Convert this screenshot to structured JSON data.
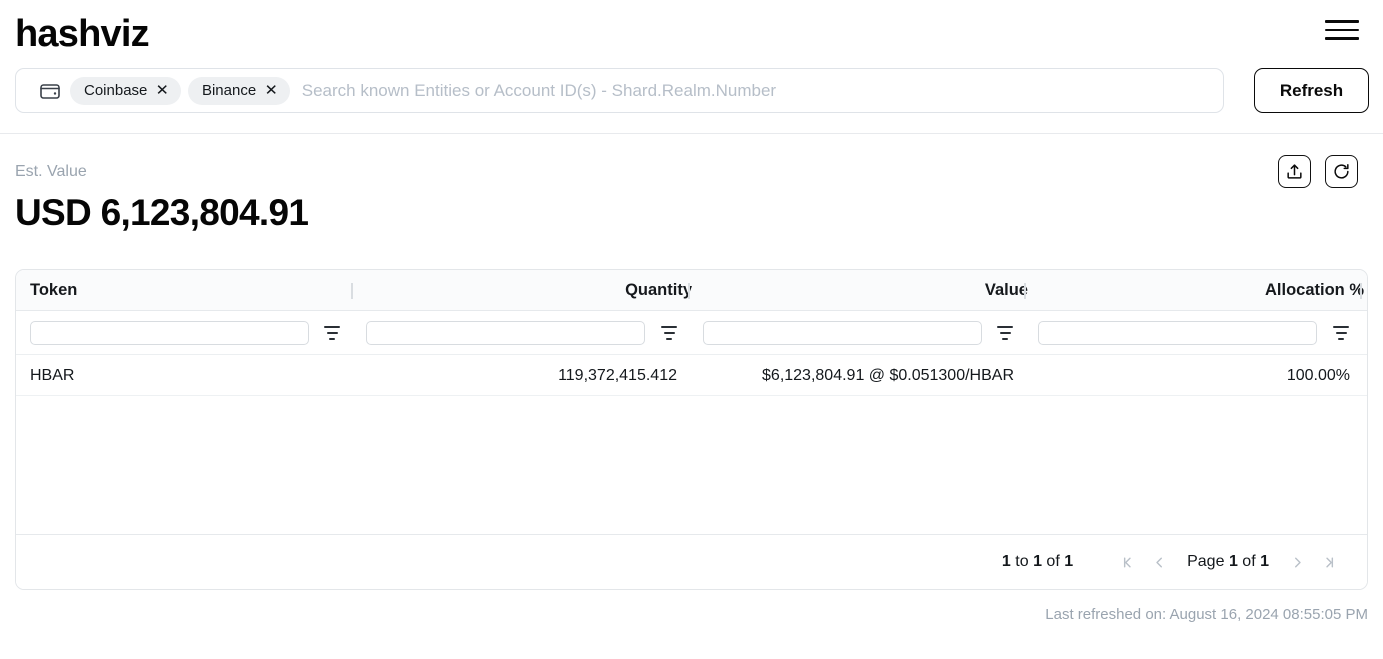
{
  "header": {
    "brand": "hashviz",
    "menu_icon": "hamburger-menu-icon"
  },
  "search": {
    "wallet_icon": "wallet-icon",
    "chips": [
      {
        "label": "Coinbase",
        "remove_label": "✕"
      },
      {
        "label": "Binance",
        "remove_label": "✕"
      }
    ],
    "value": "",
    "placeholder": "Search known Entities or Account ID(s) - Shard.Realm.Number",
    "refresh_label": "Refresh"
  },
  "summary": {
    "est_label": "Est. Value",
    "est_value": "USD 6,123,804.91",
    "export_icon": "export-upload-icon",
    "reload_icon": "reload-refresh-icon"
  },
  "table": {
    "columns": [
      {
        "key": "token",
        "label": "Token",
        "align": "left"
      },
      {
        "key": "quantity",
        "label": "Quantity",
        "align": "right"
      },
      {
        "key": "value",
        "label": "Value",
        "align": "right"
      },
      {
        "key": "allocation",
        "label": "Allocation %",
        "align": "right"
      }
    ],
    "filters": {
      "token": "",
      "quantity": "",
      "value": "",
      "allocation": ""
    },
    "rows": [
      {
        "token": "HBAR",
        "quantity": "119,372,415.412",
        "value": "$6,123,804.91 @ $0.051300/HBAR",
        "allocation": "100.00%"
      }
    ],
    "footer": {
      "range": "1 to 1 of 1",
      "range_from": "1",
      "range_to": "1",
      "range_total": "1",
      "page_label_prefix": "Page",
      "page_current": "1",
      "page_label_of": "of",
      "page_total": "1",
      "first_icon": "first-page-icon",
      "prev_icon": "previous-page-icon",
      "next_icon": "next-page-icon",
      "last_icon": "last-page-icon"
    }
  },
  "footer": {
    "last_refreshed": "Last refreshed on: August 16, 2024 08:55:05 PM"
  },
  "colors": {
    "text_primary": "#111111",
    "text_muted": "#9aa4af",
    "chip_bg": "#eef0f2",
    "border": "#e3e6e9",
    "header_bg": "#fafbfc"
  }
}
